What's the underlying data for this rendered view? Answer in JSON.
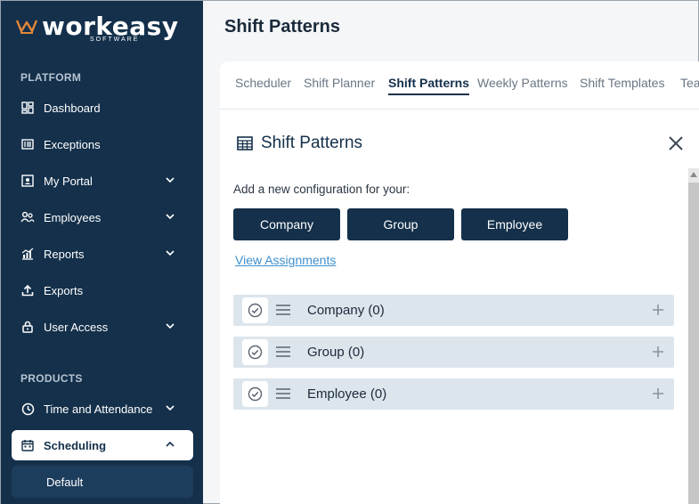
{
  "brand": {
    "name": "workeasy",
    "sub": "SOFTWARE"
  },
  "sidebar": {
    "platform_label": "PLATFORM",
    "products_label": "PRODUCTS",
    "items": [
      {
        "label": "Dashboard"
      },
      {
        "label": "Exceptions"
      },
      {
        "label": "My Portal"
      },
      {
        "label": "Employees"
      },
      {
        "label": "Reports"
      },
      {
        "label": "Exports"
      },
      {
        "label": "User Access"
      }
    ],
    "products": [
      {
        "label": "Time and Attendance"
      },
      {
        "label": "Scheduling"
      }
    ],
    "sub_item": "Default"
  },
  "header": {
    "title": "Shift Patterns"
  },
  "tabs": [
    {
      "label": "Scheduler"
    },
    {
      "label": "Shift Planner"
    },
    {
      "label": "Shift Patterns"
    },
    {
      "label": "Weekly Patterns"
    },
    {
      "label": "Shift Templates"
    },
    {
      "label": "Tea"
    }
  ],
  "panel": {
    "title": "Shift Patterns",
    "add_label": "Add a new configuration for your:",
    "buttons": [
      "Company",
      "Group",
      "Employee"
    ],
    "view_link": "View Assignments",
    "rows": [
      "Company (0)",
      "Group (0)",
      "Employee (0)"
    ]
  },
  "colors": {
    "sidebar": "#14304b",
    "accent": "#14304b",
    "link": "#3d8fce",
    "row_bg": "#dde5ec"
  }
}
